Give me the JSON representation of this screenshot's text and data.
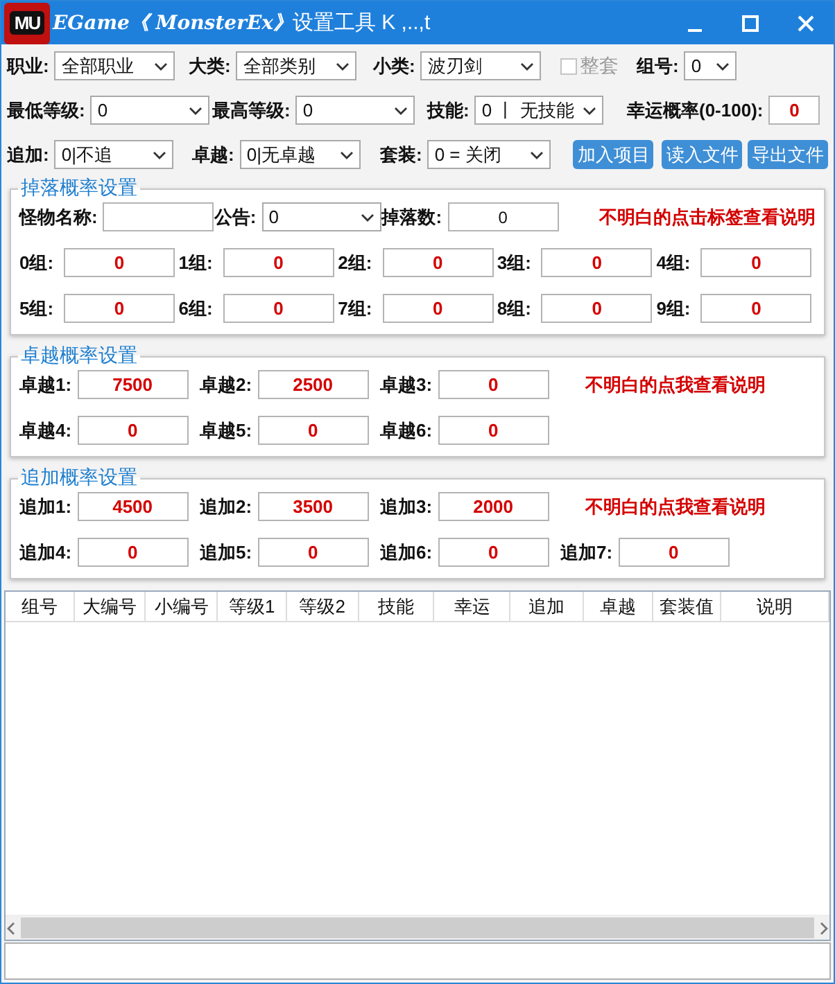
{
  "window": {
    "logo": "MU",
    "title_italic": "EGame《 MonsterEx》",
    "title": "设置工具 K ,..,t"
  },
  "filter_rows": [
    [
      {
        "kind": "combo",
        "label": "职业:",
        "value": "全部职业"
      },
      {
        "kind": "combo",
        "label": "大类:",
        "value": "全部类别"
      },
      {
        "kind": "combo",
        "label": "小类:",
        "value": "波刃剑"
      },
      {
        "kind": "checkbox",
        "label": "整套",
        "checked": false,
        "disabled": true
      },
      {
        "kind": "combo",
        "label": "组号:",
        "value": "0"
      }
    ],
    [
      {
        "kind": "combo",
        "label": "最低等级:",
        "value": "0"
      },
      {
        "kind": "combo",
        "label": "最高等级:",
        "value": "0"
      },
      {
        "kind": "combo",
        "label": "技能:",
        "value": "0 丨 无技能"
      },
      {
        "kind": "rate",
        "label": "幸运概率(0-100):",
        "value": "0"
      }
    ],
    [
      {
        "kind": "combo",
        "label": "追加:",
        "value": "0|不追"
      },
      {
        "kind": "combo",
        "label": "卓越:",
        "value": "0|无卓越"
      },
      {
        "kind": "combo",
        "label": "套装:",
        "value": "0 = 关闭"
      },
      {
        "kind": "button",
        "label": "加入项目"
      },
      {
        "kind": "button",
        "label": "读入文件"
      },
      {
        "kind": "button",
        "label": "导出文件"
      }
    ]
  ],
  "groups": [
    {
      "legend": "掉落概率设置",
      "header": [
        {
          "kind": "field",
          "label": "怪物名称:"
        },
        {
          "kind": "combo",
          "label": "公告:",
          "value": "0"
        },
        {
          "kind": "field",
          "label": "掉落数:",
          "value": "0"
        },
        {
          "kind": "note",
          "label": "不明白的点击标签查看说明"
        }
      ],
      "rows": [
        [
          {
            "kind": "rate",
            "label": "0组:",
            "value": "0"
          },
          {
            "kind": "rate",
            "label": "1组:",
            "value": "0"
          },
          {
            "kind": "rate",
            "label": "2组:",
            "value": "0"
          },
          {
            "kind": "rate",
            "label": "3组:",
            "value": "0"
          },
          {
            "kind": "rate",
            "label": "4组:",
            "value": "0"
          }
        ],
        [
          {
            "kind": "rate",
            "label": "5组:",
            "value": "0"
          },
          {
            "kind": "rate",
            "label": "6组:",
            "value": "0"
          },
          {
            "kind": "rate",
            "label": "7组:",
            "value": "0"
          },
          {
            "kind": "rate",
            "label": "8组:",
            "value": "0"
          },
          {
            "kind": "rate",
            "label": "9组:",
            "value": "0"
          }
        ]
      ]
    },
    {
      "legend": "卓越概率设置",
      "rows": [
        [
          {
            "kind": "rate",
            "label": "卓越1:",
            "value": "7500"
          },
          {
            "kind": "rate",
            "label": "卓越2:",
            "value": "2500"
          },
          {
            "kind": "rate",
            "label": "卓越3:",
            "value": "0"
          },
          {
            "kind": "note",
            "label": "不明白的点我查看说明"
          }
        ],
        [
          {
            "kind": "rate",
            "label": "卓越4:",
            "value": "0"
          },
          {
            "kind": "rate",
            "label": "卓越5:",
            "value": "0"
          },
          {
            "kind": "rate",
            "label": "卓越6:",
            "value": "0"
          }
        ]
      ]
    },
    {
      "legend": "追加概率设置",
      "rows": [
        [
          {
            "kind": "rate",
            "label": "追加1:",
            "value": "4500"
          },
          {
            "kind": "rate",
            "label": "追加2:",
            "value": "3500"
          },
          {
            "kind": "rate",
            "label": "追加3:",
            "value": "2000"
          },
          {
            "kind": "note",
            "label": "不明白的点我查看说明"
          }
        ],
        [
          {
            "kind": "rate",
            "label": "追加4:",
            "value": "0"
          },
          {
            "kind": "rate",
            "label": "追加5:",
            "value": "0"
          },
          {
            "kind": "rate",
            "label": "追加6:",
            "value": "0"
          },
          {
            "kind": "rate",
            "label": "追加7:",
            "value": "0"
          }
        ]
      ]
    }
  ],
  "table": {
    "columns": [
      "组号",
      "大编号",
      "小编号",
      "等级1",
      "等级2",
      "技能",
      "幸运",
      "追加",
      "卓越",
      "套装值",
      "说明"
    ]
  }
}
